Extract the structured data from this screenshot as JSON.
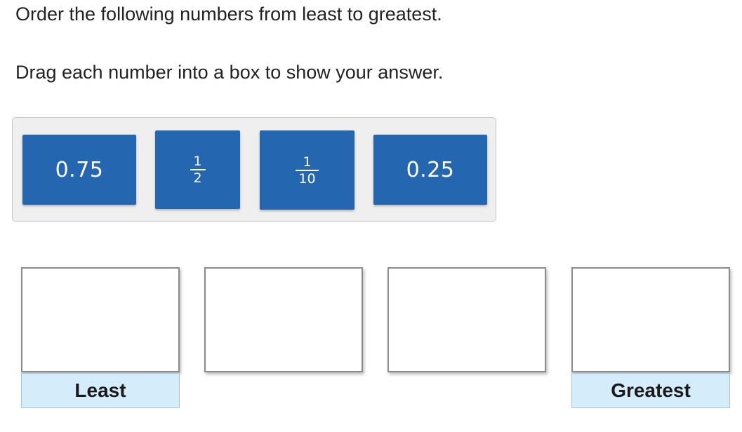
{
  "instructions": {
    "line1": "Order the following numbers from least to greatest.",
    "line2": "Drag each number into a box to show your answer."
  },
  "tiles": [
    {
      "kind": "decimal",
      "text": "0.75"
    },
    {
      "kind": "fraction",
      "numerator": "1",
      "denominator": "2"
    },
    {
      "kind": "fraction",
      "numerator": "1",
      "denominator": "10"
    },
    {
      "kind": "decimal",
      "text": "0.25"
    }
  ],
  "drop_zones": {
    "least_label": "Least",
    "greatest_label": "Greatest"
  },
  "colors": {
    "tile": "#2566b0",
    "tray_background": "#efefef",
    "label_background": "#d5ecfa"
  }
}
